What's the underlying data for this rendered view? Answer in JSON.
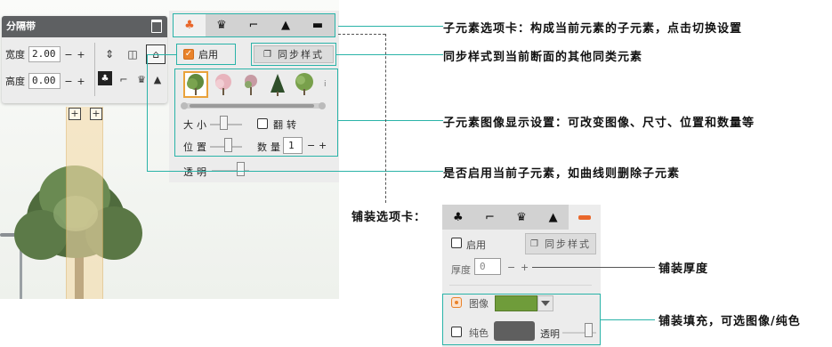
{
  "mini_panel": {
    "title": "分隔带",
    "width_label": "宽度",
    "width_value": "2.00",
    "height_label": "高度",
    "height_value": "0.00",
    "minus": "−",
    "plus": "+"
  },
  "main_panel": {
    "tabs": [
      {
        "icon": "tree-icon",
        "glyph": "♣",
        "active": true
      },
      {
        "icon": "crown-icon",
        "glyph": "♛",
        "active": false
      },
      {
        "icon": "lamp-icon",
        "glyph": "⌐",
        "active": false
      },
      {
        "icon": "cone-icon",
        "glyph": "▲",
        "active": false
      },
      {
        "icon": "curb-icon",
        "glyph": "▬",
        "active": false
      }
    ],
    "enable_label": "启用",
    "sync_label": "同步样式",
    "more_glyph": "i",
    "size_label": "大小",
    "flip_label": "翻转",
    "position_label": "位置",
    "count_label": "数量",
    "count_value": "1",
    "opacity_label": "透明",
    "minus": "−",
    "plus": "+"
  },
  "paving_panel": {
    "enable_label": "启用",
    "sync_label": "同步样式",
    "thickness_label": "厚度",
    "thickness_value": "0",
    "image_label": "图像",
    "solid_label": "纯色",
    "opacity_label": "透明",
    "minus": "−",
    "plus": "+",
    "grass_color": "#6f9c3a",
    "solid_color": "#5f5f5f"
  },
  "callouts": {
    "sub_tabs": "子元素选项卡：构成当前元素的子元素，点击切换设置",
    "sync": "同步样式到当前断面的其他同类元素",
    "image_settings": "子元素图像显示设置：可改变图像、尺寸、位置和数量等",
    "enable": "是否启用当前子元素，如曲线则删除子元素",
    "paving_tab": "铺装选项卡：",
    "thickness": "铺装厚度",
    "fill": "铺装填充，可选图像/纯色"
  },
  "colors": {
    "accent": "#e9672b",
    "callout_line": "#2ab3a8",
    "panel_bg": "#ececec"
  }
}
